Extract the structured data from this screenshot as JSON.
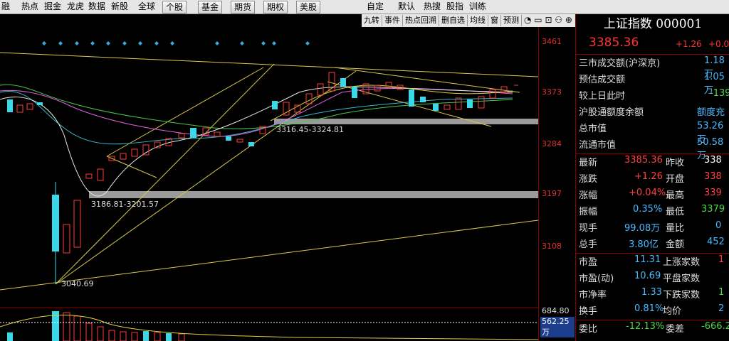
{
  "menu": {
    "tabs": [
      "融",
      "热点",
      "掘金",
      "龙虎",
      "数据",
      "新股",
      "全球"
    ],
    "buttons": [
      "个股",
      "基金",
      "期货",
      "期权",
      "美股"
    ],
    "right_tabs": [
      "自定",
      "默认",
      "热搜",
      "股指",
      "训练"
    ]
  },
  "toolbar": [
    "九转",
    "事件",
    "热点回溯",
    "删自选",
    "均线",
    "窗",
    "预测"
  ],
  "yaxis": {
    "labels": [
      "3461",
      "3373",
      "3284",
      "3197",
      "3108"
    ],
    "vol_labels": [
      "684.80万",
      "562.25万"
    ]
  },
  "annotations": {
    "low_label": "3040.69",
    "range1": "3186.81-3201.57",
    "range2": "3316.45-3324.81"
  },
  "panel": {
    "title": "上证指数 000001",
    "price": "3385.36",
    "change": "+1.26",
    "change_pct": "+0.0",
    "rows1": [
      {
        "k": "三市成交额(沪深京)",
        "v": "1.18万"
      },
      {
        "k": "预估成交额",
        "v": "1.05万"
      },
      {
        "k": "较上日此时",
        "v": "-139"
      },
      {
        "k": "沪股通额度余额",
        "v": "额度充"
      },
      {
        "k": "总市值",
        "v": "53.26万"
      },
      {
        "k": "流通市值",
        "v": "50.58万"
      }
    ],
    "rows2": [
      {
        "k": "最新",
        "v": "3385.36",
        "k2": "昨收",
        "v2": "338"
      },
      {
        "k": "涨跌",
        "v": "+1.26",
        "k2": "开盘",
        "v2": "338"
      },
      {
        "k": "涨幅",
        "v": "+0.04%",
        "k2": "最高",
        "v2": "339"
      },
      {
        "k": "振幅",
        "v": "0.35%",
        "k2": "最低",
        "v2": "3379"
      },
      {
        "k": "现手",
        "v": "99.08万",
        "k2": "量比",
        "v2": "0"
      },
      {
        "k": "总手",
        "v": "3.80亿",
        "k2": "金额",
        "v2": "452"
      }
    ],
    "rows3": [
      {
        "k": "市盈",
        "v": "11.31",
        "k2": "上涨家数",
        "v2": "1"
      },
      {
        "k": "市盈(动)",
        "v": "10.69",
        "k2": "平盘家数",
        "v2": ""
      },
      {
        "k": "市净率",
        "v": "1.33",
        "k2": "下跌家数",
        "v2": "1"
      },
      {
        "k": "换手",
        "v": "0.81%",
        "k2": "均价",
        "v2": "2"
      }
    ],
    "bottom": {
      "k": "委比",
      "v": "-12.13%",
      "k2": "委差",
      "v2": "-666.2"
    }
  }
}
